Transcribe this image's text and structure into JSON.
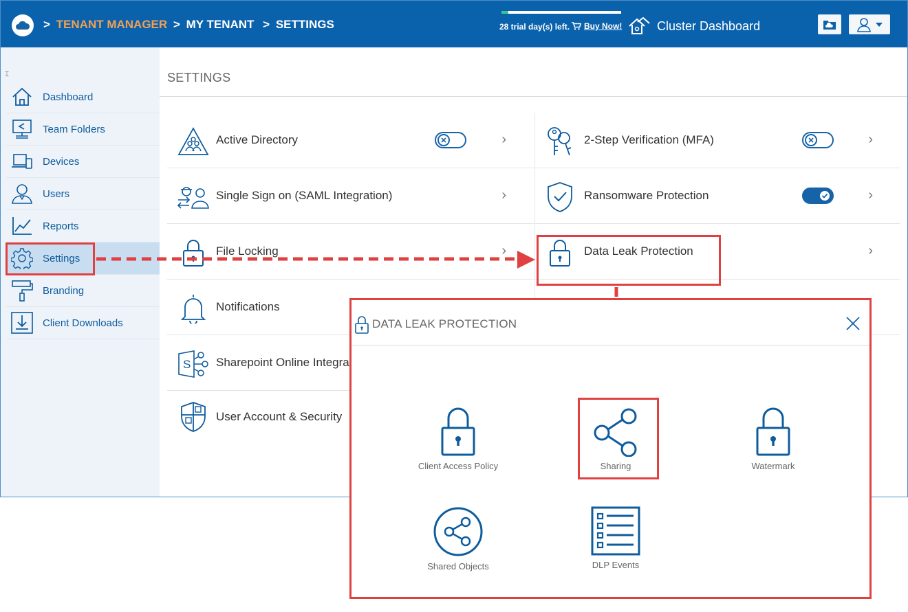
{
  "header": {
    "breadcrumb": [
      {
        "sep": ">",
        "label": "TENANT MANAGER",
        "active": true
      },
      {
        "sep": ">",
        "label": "MY TENANT",
        "active": false
      },
      {
        "sep": ">",
        "label": "SETTINGS",
        "active": false
      }
    ],
    "trial_text": "28 trial day(s) left.",
    "trial_progress": 0.06,
    "buy_now": "Buy Now!",
    "cluster_dashboard": "Cluster Dashboard"
  },
  "sidebar": {
    "collapse_glyph": "⌶",
    "items": [
      {
        "label": "Dashboard",
        "icon": "home-icon"
      },
      {
        "label": "Team Folders",
        "icon": "team-folders-icon"
      },
      {
        "label": "Devices",
        "icon": "devices-icon"
      },
      {
        "label": "Users",
        "icon": "users-icon"
      },
      {
        "label": "Reports",
        "icon": "reports-icon"
      },
      {
        "label": "Settings",
        "icon": "gear-icon",
        "active": true
      },
      {
        "label": "Branding",
        "icon": "paint-roller-icon"
      },
      {
        "label": "Client Downloads",
        "icon": "download-icon"
      }
    ]
  },
  "main": {
    "title": "SETTINGS",
    "left": [
      {
        "label": "Active Directory",
        "toggle": "off"
      },
      {
        "label": "Single Sign on (SAML Integration)"
      },
      {
        "label": "File Locking"
      },
      {
        "label": "Notifications"
      },
      {
        "label": "Sharepoint Online Integra"
      },
      {
        "label": "User Account & Security"
      }
    ],
    "right": [
      {
        "label": "2-Step Verification (MFA)",
        "toggle": "off"
      },
      {
        "label": "Ransomware Protection",
        "toggle": "on"
      },
      {
        "label": "Data Leak Protection"
      }
    ]
  },
  "modal": {
    "title": "DATA LEAK PROTECTION",
    "tiles": [
      {
        "label": "Client Access Policy"
      },
      {
        "label": "Sharing"
      },
      {
        "label": "Watermark"
      },
      {
        "label": "Shared Objects"
      },
      {
        "label": "DLP Events"
      }
    ]
  },
  "colors": {
    "brand": "#0b62ac",
    "accent": "#f0a055",
    "highlight": "#e04040"
  }
}
